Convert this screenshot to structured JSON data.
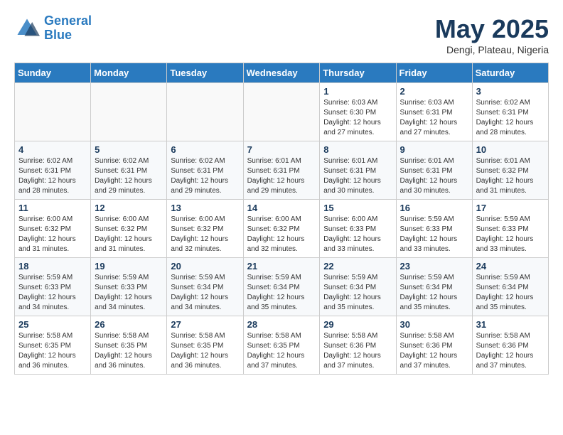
{
  "header": {
    "logo_line1": "General",
    "logo_line2": "Blue",
    "month_year": "May 2025",
    "location": "Dengi, Plateau, Nigeria"
  },
  "days_of_week": [
    "Sunday",
    "Monday",
    "Tuesday",
    "Wednesday",
    "Thursday",
    "Friday",
    "Saturday"
  ],
  "weeks": [
    [
      {
        "day": "",
        "content": ""
      },
      {
        "day": "",
        "content": ""
      },
      {
        "day": "",
        "content": ""
      },
      {
        "day": "",
        "content": ""
      },
      {
        "day": "1",
        "content": "Sunrise: 6:03 AM\nSunset: 6:30 PM\nDaylight: 12 hours\nand 27 minutes."
      },
      {
        "day": "2",
        "content": "Sunrise: 6:03 AM\nSunset: 6:31 PM\nDaylight: 12 hours\nand 27 minutes."
      },
      {
        "day": "3",
        "content": "Sunrise: 6:02 AM\nSunset: 6:31 PM\nDaylight: 12 hours\nand 28 minutes."
      }
    ],
    [
      {
        "day": "4",
        "content": "Sunrise: 6:02 AM\nSunset: 6:31 PM\nDaylight: 12 hours\nand 28 minutes."
      },
      {
        "day": "5",
        "content": "Sunrise: 6:02 AM\nSunset: 6:31 PM\nDaylight: 12 hours\nand 29 minutes."
      },
      {
        "day": "6",
        "content": "Sunrise: 6:02 AM\nSunset: 6:31 PM\nDaylight: 12 hours\nand 29 minutes."
      },
      {
        "day": "7",
        "content": "Sunrise: 6:01 AM\nSunset: 6:31 PM\nDaylight: 12 hours\nand 29 minutes."
      },
      {
        "day": "8",
        "content": "Sunrise: 6:01 AM\nSunset: 6:31 PM\nDaylight: 12 hours\nand 30 minutes."
      },
      {
        "day": "9",
        "content": "Sunrise: 6:01 AM\nSunset: 6:31 PM\nDaylight: 12 hours\nand 30 minutes."
      },
      {
        "day": "10",
        "content": "Sunrise: 6:01 AM\nSunset: 6:32 PM\nDaylight: 12 hours\nand 31 minutes."
      }
    ],
    [
      {
        "day": "11",
        "content": "Sunrise: 6:00 AM\nSunset: 6:32 PM\nDaylight: 12 hours\nand 31 minutes."
      },
      {
        "day": "12",
        "content": "Sunrise: 6:00 AM\nSunset: 6:32 PM\nDaylight: 12 hours\nand 31 minutes."
      },
      {
        "day": "13",
        "content": "Sunrise: 6:00 AM\nSunset: 6:32 PM\nDaylight: 12 hours\nand 32 minutes."
      },
      {
        "day": "14",
        "content": "Sunrise: 6:00 AM\nSunset: 6:32 PM\nDaylight: 12 hours\nand 32 minutes."
      },
      {
        "day": "15",
        "content": "Sunrise: 6:00 AM\nSunset: 6:33 PM\nDaylight: 12 hours\nand 33 minutes."
      },
      {
        "day": "16",
        "content": "Sunrise: 5:59 AM\nSunset: 6:33 PM\nDaylight: 12 hours\nand 33 minutes."
      },
      {
        "day": "17",
        "content": "Sunrise: 5:59 AM\nSunset: 6:33 PM\nDaylight: 12 hours\nand 33 minutes."
      }
    ],
    [
      {
        "day": "18",
        "content": "Sunrise: 5:59 AM\nSunset: 6:33 PM\nDaylight: 12 hours\nand 34 minutes."
      },
      {
        "day": "19",
        "content": "Sunrise: 5:59 AM\nSunset: 6:33 PM\nDaylight: 12 hours\nand 34 minutes."
      },
      {
        "day": "20",
        "content": "Sunrise: 5:59 AM\nSunset: 6:34 PM\nDaylight: 12 hours\nand 34 minutes."
      },
      {
        "day": "21",
        "content": "Sunrise: 5:59 AM\nSunset: 6:34 PM\nDaylight: 12 hours\nand 35 minutes."
      },
      {
        "day": "22",
        "content": "Sunrise: 5:59 AM\nSunset: 6:34 PM\nDaylight: 12 hours\nand 35 minutes."
      },
      {
        "day": "23",
        "content": "Sunrise: 5:59 AM\nSunset: 6:34 PM\nDaylight: 12 hours\nand 35 minutes."
      },
      {
        "day": "24",
        "content": "Sunrise: 5:59 AM\nSunset: 6:34 PM\nDaylight: 12 hours\nand 35 minutes."
      }
    ],
    [
      {
        "day": "25",
        "content": "Sunrise: 5:58 AM\nSunset: 6:35 PM\nDaylight: 12 hours\nand 36 minutes."
      },
      {
        "day": "26",
        "content": "Sunrise: 5:58 AM\nSunset: 6:35 PM\nDaylight: 12 hours\nand 36 minutes."
      },
      {
        "day": "27",
        "content": "Sunrise: 5:58 AM\nSunset: 6:35 PM\nDaylight: 12 hours\nand 36 minutes."
      },
      {
        "day": "28",
        "content": "Sunrise: 5:58 AM\nSunset: 6:35 PM\nDaylight: 12 hours\nand 37 minutes."
      },
      {
        "day": "29",
        "content": "Sunrise: 5:58 AM\nSunset: 6:36 PM\nDaylight: 12 hours\nand 37 minutes."
      },
      {
        "day": "30",
        "content": "Sunrise: 5:58 AM\nSunset: 6:36 PM\nDaylight: 12 hours\nand 37 minutes."
      },
      {
        "day": "31",
        "content": "Sunrise: 5:58 AM\nSunset: 6:36 PM\nDaylight: 12 hours\nand 37 minutes."
      }
    ]
  ]
}
